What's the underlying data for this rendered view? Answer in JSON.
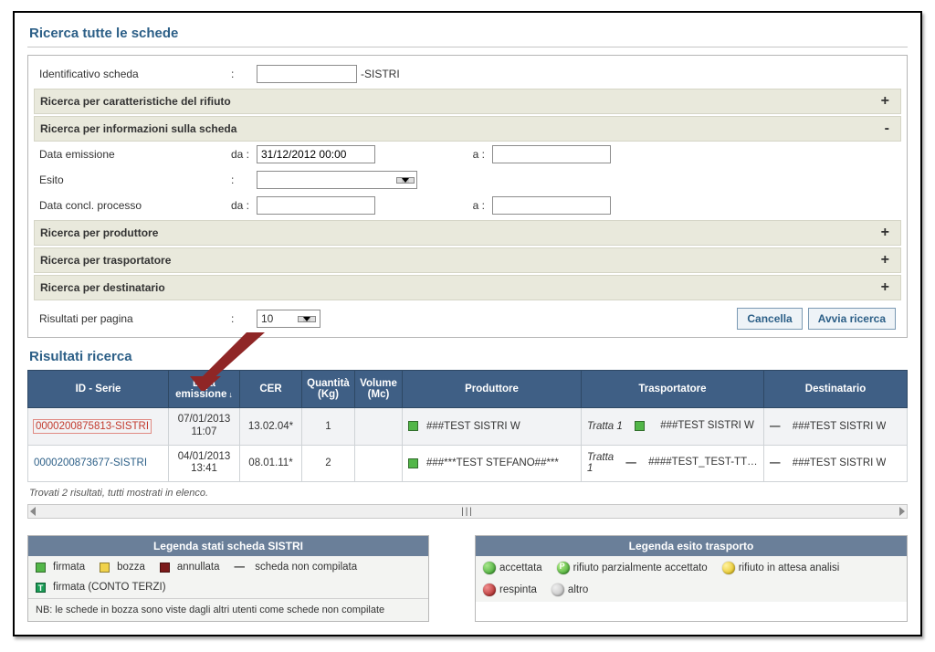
{
  "mainTitle": "Ricerca tutte le schede",
  "search": {
    "idLabel": "Identificativo scheda",
    "idSuffix": "-SISTRI",
    "idValue": "",
    "band_rifiuto": "Ricerca per caratteristiche del rifiuto",
    "band_info": "Ricerca per informazioni sulla scheda",
    "dataEmissLabel": "Data emissione",
    "daLabel": "da :",
    "daValue": "31/12/2012 00:00",
    "aLabel": "a :",
    "aValue": "",
    "esitoLabel": "Esito",
    "processoLabel": "Data concl. processo",
    "procDaValue": "",
    "procAValue": "",
    "band_prod": "Ricerca per produttore",
    "band_trasp": "Ricerca per trasportatore",
    "band_dest": "Ricerca per destinatario",
    "perPageLabel": "Risultati per pagina",
    "perPageValue": "10",
    "cancel": "Cancella",
    "go": "Avvia ricerca",
    "plus": "+",
    "minus": "-"
  },
  "resultsTitle": "Risultati ricerca",
  "cols": {
    "id": "ID - Serie",
    "data": "Data emissione",
    "cer": "CER",
    "qta": "Quantità (Kg)",
    "vol": "Volume (Mc)",
    "prod": "Produttore",
    "trasp": "Trasportatore",
    "dest": "Destinatario"
  },
  "rows": [
    {
      "id": "0000200875813-SISTRI",
      "idHot": true,
      "date": "07/01/2013 11:07",
      "cer": "13.02.04*",
      "qta": "1",
      "vol": "",
      "prod": "###TEST SISTRI W",
      "tratta": "Tratta 1",
      "trasp": "###TEST SISTRI W",
      "traspSq": true,
      "dest": "###TEST SISTRI W"
    },
    {
      "id": "0000200873677-SISTRI",
      "idHot": false,
      "date": "04/01/2013 13:41",
      "cer": "08.01.11*",
      "qta": "2",
      "vol": "",
      "prod": "###***TEST STEFANO##***",
      "tratta": "Tratta 1",
      "trasp": "####TEST_TEST-TTRA IACONA",
      "traspSq": false,
      "dest": "###TEST SISTRI W"
    }
  ],
  "found": "Trovati 2 risultati, tutti mostrati in elenco.",
  "legend1": {
    "title": "Legenda stati scheda SISTRI",
    "firmata": "firmata",
    "bozza": "bozza",
    "annullata": "annullata",
    "noncomp": "scheda non compilata",
    "contoterzi": "firmata (CONTO TERZI)",
    "nb": "NB: le schede in bozza sono viste dagli altri utenti come schede non compilate"
  },
  "legend2": {
    "title": "Legenda esito trasporto",
    "acc": "accettata",
    "parz": "rifiuto parzialmente accettato",
    "attesa": "rifiuto in attesa analisi",
    "resp": "respinta",
    "altro": "altro"
  }
}
